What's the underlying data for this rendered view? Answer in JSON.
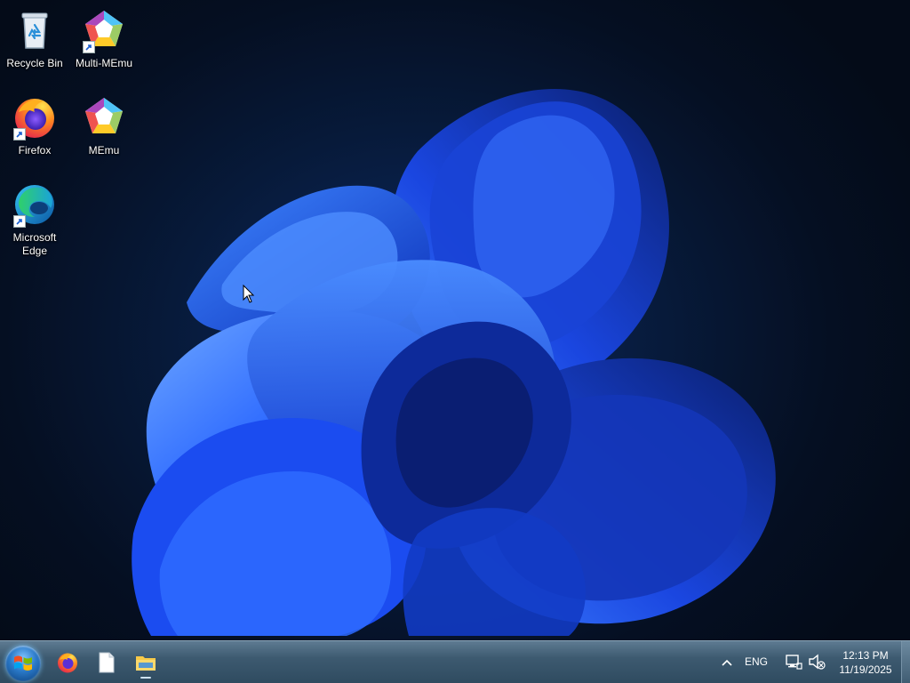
{
  "desktop": {
    "icons": [
      {
        "name": "recycle-bin",
        "label": "Recycle Bin",
        "icon": "recycle-bin-icon",
        "shortcut": false
      },
      {
        "name": "multi-memu",
        "label": "Multi-MEmu",
        "icon": "multi-memu-icon",
        "shortcut": true
      },
      {
        "name": "firefox",
        "label": "Firefox",
        "icon": "firefox-icon",
        "shortcut": true
      },
      {
        "name": "memu",
        "label": "MEmu",
        "icon": "memu-icon",
        "shortcut": false
      },
      {
        "name": "microsoft-edge",
        "label": "Microsoft Edge",
        "icon": "edge-icon",
        "shortcut": true
      }
    ],
    "wallpaper": "windows-11-bloom"
  },
  "taskbar": {
    "start": {
      "icon": "windows-logo-icon"
    },
    "pinned_apps": [
      {
        "name": "firefox",
        "icon": "firefox-icon",
        "running": false
      },
      {
        "name": "notepad",
        "icon": "blank-document-icon",
        "running": false
      },
      {
        "name": "file-explorer",
        "icon": "folder-icon",
        "running": true
      }
    ],
    "tray": {
      "chevron_icon": "chevron-up-icon",
      "language": "ENG",
      "network_icon": "network-icon",
      "volume_icon": "volume-muted-icon",
      "time": "12:13 PM",
      "date": "11/19/2025"
    }
  },
  "colors": {
    "accent": "#1e5cff",
    "taskbar": "#3d5a70",
    "desktop_bg": "#071a3a"
  }
}
